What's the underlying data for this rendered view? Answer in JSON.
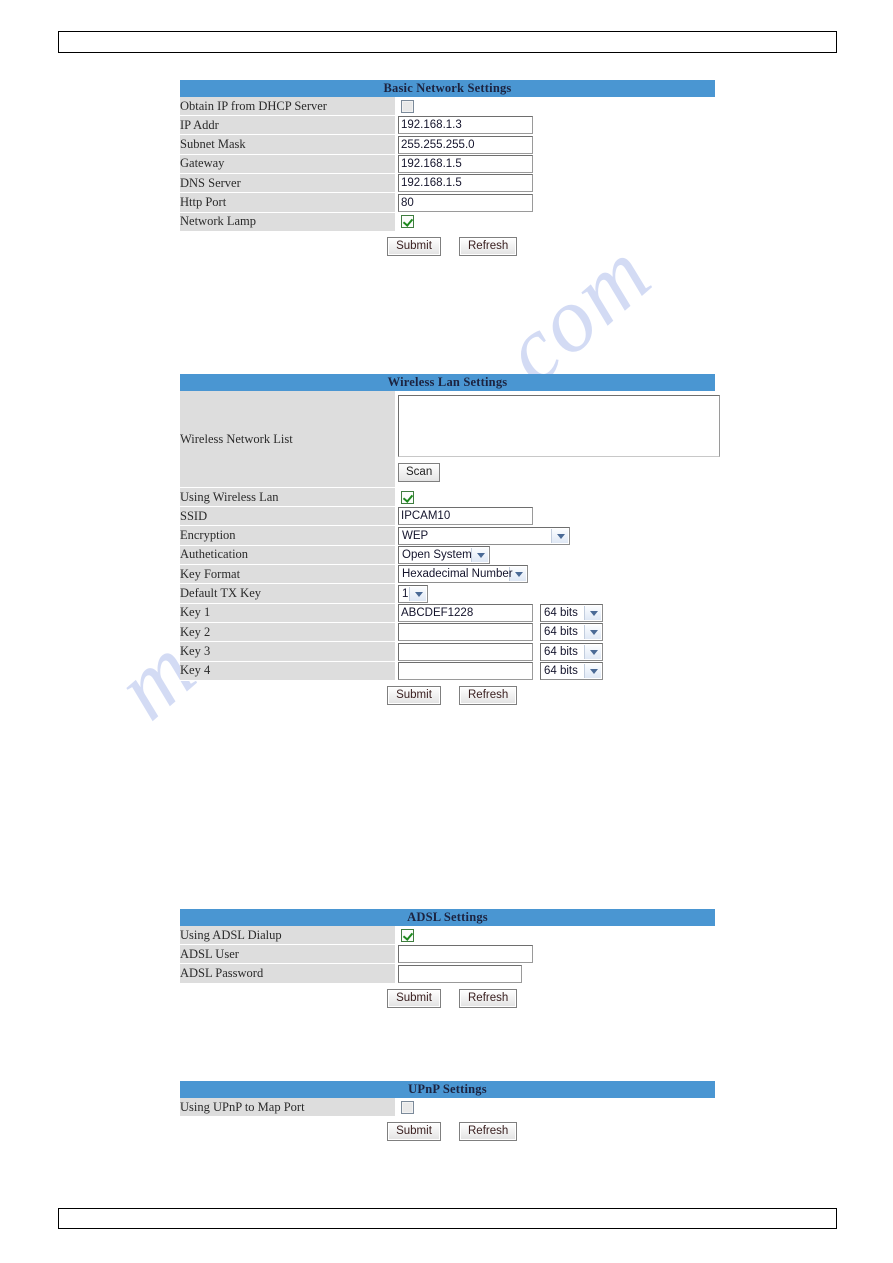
{
  "page": {
    "running_head": "",
    "running_foot": "",
    "watermark": "manualshive.com"
  },
  "colors": {
    "panel_header_bg": "#4a96d2",
    "label_cell_bg": "#dddddd",
    "checkmark": "#1d8a1d",
    "watermark": "#b9c6ee"
  },
  "common": {
    "submit_label": "Submit",
    "refresh_label": "Refresh"
  },
  "panels": {
    "basic_network": {
      "title": "Basic Network Settings",
      "rows": [
        {
          "label": "Obtain IP from DHCP Server",
          "type": "checkbox",
          "checked": false
        },
        {
          "label": "IP Addr",
          "type": "text",
          "value": "192.168.1.3"
        },
        {
          "label": "Subnet Mask",
          "type": "text",
          "value": "255.255.255.0"
        },
        {
          "label": "Gateway",
          "type": "text",
          "value": "192.168.1.5"
        },
        {
          "label": "DNS Server",
          "type": "text",
          "value": "192.168.1.5"
        },
        {
          "label": "Http Port",
          "type": "text",
          "value": "80"
        },
        {
          "label": "Network Lamp",
          "type": "checkbox",
          "checked": true
        }
      ]
    },
    "wireless_lan": {
      "title": "Wireless Lan Settings",
      "network_list_label": "Wireless Network List",
      "network_list_value": "",
      "scan_label": "Scan",
      "rows": [
        {
          "label": "Using Wireless Lan",
          "type": "checkbox",
          "checked": true
        },
        {
          "label": "SSID",
          "type": "text",
          "value": "IPCAM10"
        },
        {
          "label": "Encryption",
          "type": "select",
          "value": "WEP"
        },
        {
          "label": "Authetication",
          "type": "select",
          "value": "Open System"
        },
        {
          "label": "Key Format",
          "type": "select",
          "value": "Hexadecimal Number"
        },
        {
          "label": "Default TX Key",
          "type": "select",
          "value": "1"
        },
        {
          "label": "Key 1",
          "type": "key",
          "value": "ABCDEF1228",
          "bits": "64 bits"
        },
        {
          "label": "Key 2",
          "type": "key",
          "value": "",
          "bits": "64 bits"
        },
        {
          "label": "Key 3",
          "type": "key",
          "value": "",
          "bits": "64 bits"
        },
        {
          "label": "Key 4",
          "type": "key",
          "value": "",
          "bits": "64 bits"
        }
      ]
    },
    "adsl": {
      "title": "ADSL Settings",
      "rows": [
        {
          "label": "Using ADSL Dialup",
          "type": "checkbox",
          "checked": true
        },
        {
          "label": "ADSL User",
          "type": "text",
          "value": ""
        },
        {
          "label": "ADSL Password",
          "type": "password",
          "value": ""
        }
      ]
    },
    "upnp": {
      "title": "UPnP Settings",
      "rows": [
        {
          "label": "Using UPnP to Map Port",
          "type": "checkbox",
          "checked": false
        }
      ]
    }
  }
}
